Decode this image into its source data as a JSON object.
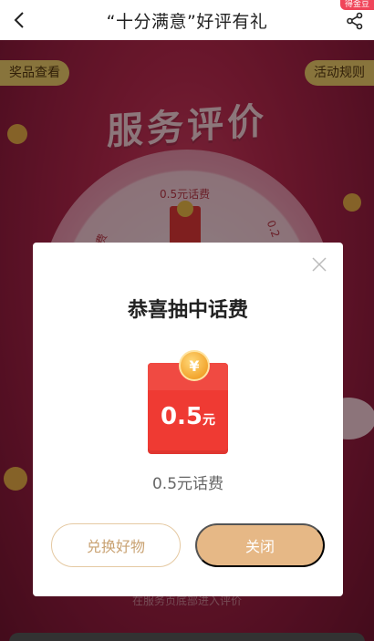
{
  "navbar": {
    "title": "“十分满意”好评有礼",
    "badge": "得金豆"
  },
  "background": {
    "banner_title": "服务评价",
    "prize_view_label": "奖品查看",
    "rules_label": "活动规则",
    "wheel_labels": [
      "0.5元话费",
      "费",
      "0.2"
    ],
    "hint": "在服务页底部进入评价"
  },
  "modal": {
    "title": "恭喜抽中话费",
    "coin_symbol": "¥",
    "amount_number": "0.5",
    "amount_unit": "元",
    "prize_name": "0.5元话费",
    "exchange_button": "兑换好物",
    "close_button": "关闭"
  },
  "colors": {
    "accent": "#e6b886",
    "envelope": "#ef3a33",
    "background": "#c02a50"
  },
  "icons": {
    "back": "chevron-left-icon",
    "share": "share-icon",
    "close": "close-icon",
    "coin": "yuan-coin-icon"
  }
}
